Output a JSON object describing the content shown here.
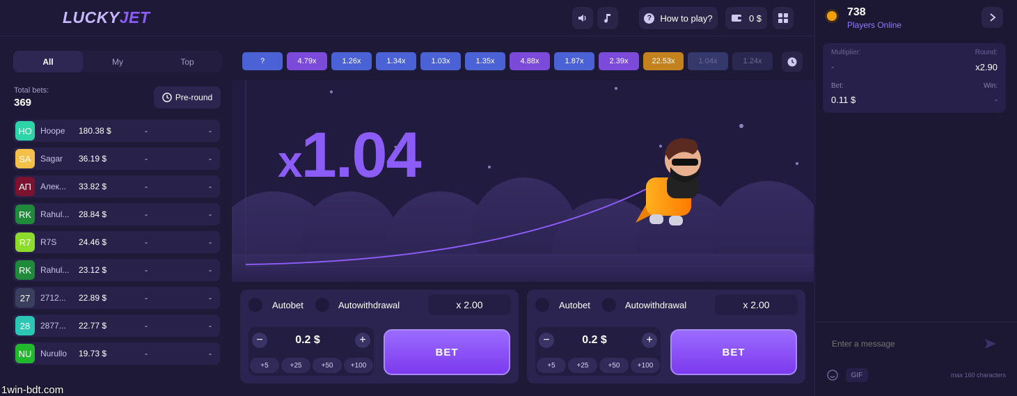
{
  "header": {
    "logo_a": "LUCKY",
    "logo_b": "JET",
    "how_to_play": "How to play?",
    "balance": "0 $"
  },
  "online": {
    "count": "738",
    "label": "Players Online"
  },
  "tabs": [
    "All",
    "My",
    "Top"
  ],
  "total_bets": {
    "label": "Total bets:",
    "value": "369"
  },
  "pre_round": "Pre-round",
  "bets": [
    {
      "initials": "HO",
      "color": "#2dd4a7",
      "name": "Hoope",
      "amount": "180.38 $",
      "mult": "-",
      "win": "-"
    },
    {
      "initials": "SA",
      "color": "#f5c04a",
      "name": "Sagar",
      "amount": "36.19 $",
      "mult": "-",
      "win": "-"
    },
    {
      "initials": "АП",
      "color": "#7a1230",
      "name": "Алек...",
      "amount": "33.82 $",
      "mult": "-",
      "win": "-"
    },
    {
      "initials": "RK",
      "color": "#1f8a3a",
      "name": "Rahul...",
      "amount": "28.84 $",
      "mult": "-",
      "win": "-"
    },
    {
      "initials": "R7",
      "color": "#8ddc2c",
      "name": "R7S",
      "amount": "24.46 $",
      "mult": "-",
      "win": "-"
    },
    {
      "initials": "RK",
      "color": "#1f8a3a",
      "name": "Rahul...",
      "amount": "23.12 $",
      "mult": "-",
      "win": "-"
    },
    {
      "initials": "27",
      "color": "#3b3f5e",
      "name": "2712...",
      "amount": "22.89 $",
      "mult": "-",
      "win": "-"
    },
    {
      "initials": "28",
      "color": "#2cc6b5",
      "name": "2877...",
      "amount": "22.77 $",
      "mult": "-",
      "win": "-"
    },
    {
      "initials": "NU",
      "color": "#22b82e",
      "name": "Nurullo",
      "amount": "19.73 $",
      "mult": "-",
      "win": "-"
    }
  ],
  "multipliers": [
    {
      "label": "?",
      "color": "#4a62d6"
    },
    {
      "label": "4.79x",
      "color": "#7c4ad8"
    },
    {
      "label": "1.26x",
      "color": "#4a62d6"
    },
    {
      "label": "1.34x",
      "color": "#4a62d6"
    },
    {
      "label": "1.03x",
      "color": "#4a62d6"
    },
    {
      "label": "1.35x",
      "color": "#4a62d6"
    },
    {
      "label": "4.88x",
      "color": "#7c4ad8"
    },
    {
      "label": "1.87x",
      "color": "#4a62d6"
    },
    {
      "label": "2.39x",
      "color": "#7c4ad8"
    },
    {
      "label": "22.53x",
      "color": "#c4821e"
    },
    {
      "label": "1.04x",
      "color": "#34386a"
    },
    {
      "label": "1.24x",
      "color": "#2a2750"
    }
  ],
  "game": {
    "multiplier": "x1.04"
  },
  "last_bet": {
    "multiplier_label": "Multiplier:",
    "multiplier_value": "-",
    "round_label": "Round:",
    "round_value": "x2.90",
    "bet_label": "Bet:",
    "bet_value": "0.11 $",
    "win_label": "Win:",
    "win_value": "-"
  },
  "bet_panels": [
    {
      "autobet": "Autobet",
      "autowithdrawal": "Autowithdrawal",
      "auto_mult": "x 2.00",
      "amount": "0.2 $",
      "minus": "−",
      "plus": "+",
      "quick": [
        "+5",
        "+25",
        "+50",
        "+100"
      ],
      "bet": "BET"
    },
    {
      "autobet": "Autobet",
      "autowithdrawal": "Autowithdrawal",
      "auto_mult": "x 2.00",
      "amount": "0.2 $",
      "minus": "−",
      "plus": "+",
      "quick": [
        "+5",
        "+25",
        "+50",
        "+100"
      ],
      "bet": "BET"
    }
  ],
  "chat": {
    "placeholder": "Enter a message",
    "gif": "GIF",
    "limit": "max 160 characters"
  },
  "watermark": "1win-bdt.com"
}
